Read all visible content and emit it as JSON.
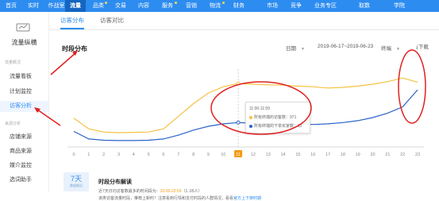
{
  "topnav": {
    "items": [
      {
        "label": "首页"
      },
      {
        "label": "实时"
      },
      {
        "label": "作战室"
      },
      {
        "label": "流量"
      },
      {
        "label": "品类"
      },
      {
        "label": "交易"
      },
      {
        "label": "内容"
      },
      {
        "label": "服务"
      },
      {
        "label": "营销"
      },
      {
        "label": "物流"
      },
      {
        "label": "财务"
      },
      {
        "label": "市场"
      },
      {
        "label": "竞争"
      },
      {
        "label": "业务专区"
      },
      {
        "label": "取数"
      },
      {
        "label": "学院"
      }
    ],
    "active_index": 3
  },
  "sidebar": {
    "title": "流量纵横",
    "section1": "流量概况",
    "items1": [
      "流量看板",
      "计划监控",
      "访客分析"
    ],
    "section2": "来源分析",
    "items2": [
      "店铺来源",
      "商品来源",
      "媒介监控",
      "选词助手"
    ],
    "active_item": "访客分析"
  },
  "tabs": [
    "访客分布",
    "访客对比"
  ],
  "section_title": "时段分布",
  "controls": {
    "period": "日期",
    "date_range": "2019-06-17~2019-06-23",
    "terminal": "终端",
    "download": "下载"
  },
  "tooltip": {
    "time": "11:00-11:59",
    "line1_label": "所有终端的访客数",
    "line1_value": "971",
    "line2_label": "所有终端的下单买家数",
    "line2_value": "12"
  },
  "bottom": {
    "card_big": "7天",
    "card_small": "数据概况",
    "title": "时段分布解读",
    "text1_prefix": "近7天日均访客数最多的时间段为：",
    "text1_highlight": "20:00-22:59",
    "text1_suffix": "（1..65人）",
    "text2_prefix": "该类访客流量时段，推荐上新时！注意看到行情和支付时段的人群情况，看看",
    "text2_link": "官方上下架时期"
  },
  "chart_data": {
    "type": "line",
    "x": [
      "0",
      "1",
      "2",
      "3",
      "4",
      "5",
      "6",
      "7",
      "8",
      "9",
      "10",
      "11",
      "12",
      "13",
      "14",
      "15",
      "16",
      "17",
      "18",
      "19",
      "20",
      "21",
      "22",
      "23"
    ],
    "highlight_x": "11",
    "series": [
      {
        "name": "所有终端的访客数",
        "color": "#f5c242",
        "values": [
          420,
          250,
          200,
          190,
          195,
          200,
          250,
          450,
          650,
          820,
          920,
          971,
          960,
          950,
          945,
          930,
          920,
          900,
          910,
          930,
          960,
          1000,
          1060,
          990
        ]
      },
      {
        "name": "所有终端的下单买家数",
        "color": "#2a62c8",
        "values": [
          210,
          90,
          70,
          65,
          65,
          70,
          90,
          150,
          230,
          290,
          330,
          350,
          340,
          335,
          330,
          325,
          320,
          330,
          350,
          380,
          430,
          500,
          600,
          870
        ]
      }
    ],
    "ylim": [
      0,
      1200
    ],
    "grid": false
  },
  "colors": {
    "primary": "#2d8cf0",
    "annotation_red": "#e02020"
  }
}
